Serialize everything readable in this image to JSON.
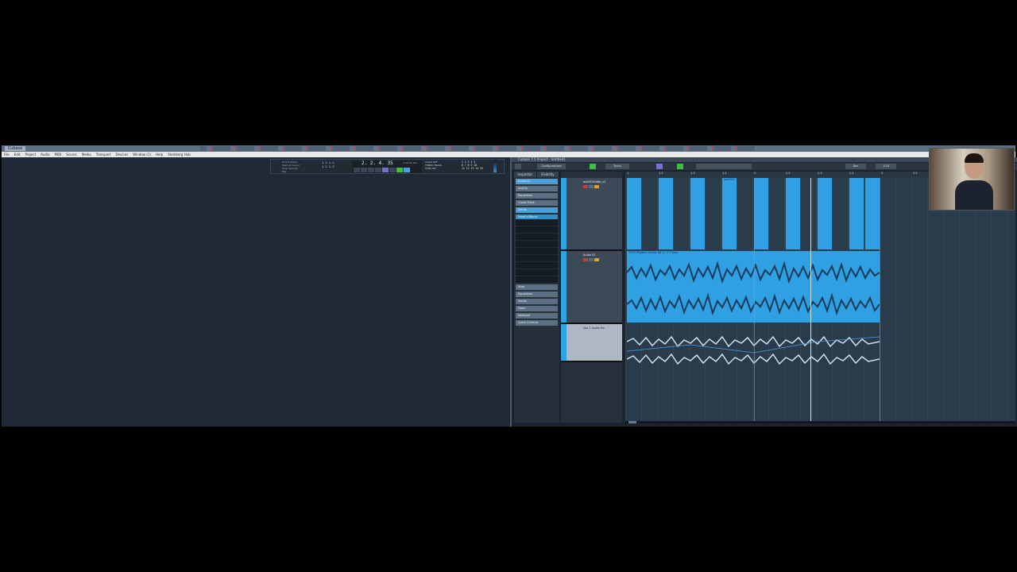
{
  "titlebar": {
    "logo": "Cubase"
  },
  "menu": [
    "File",
    "Edit",
    "Project",
    "Audio",
    "MIDI",
    "Scores",
    "Media",
    "Transport",
    "Devices",
    "Window (1)",
    "Help",
    "Steinberg Hub"
  ],
  "transport": {
    "markers": [
      "Punch In/Out",
      "Start at Cursor",
      "Stop Velocity",
      "Mix"
    ],
    "positions": [
      "1. 1. 1. 0",
      "1. 1. 1. 0"
    ],
    "time": "2. 2. 4. 35",
    "time_sub": "0:00:02.362",
    "click": [
      "CLICK OFF",
      "TEMPO TRACK",
      "SYNC INT"
    ],
    "grid": [
      "1 2 3 4 5",
      "6 7 8 9 10",
      "11 12 13 14 15"
    ]
  },
  "cubase": {
    "title": "Cubase 7.5 Project - Untitled1",
    "toolbar": {
      "configurations": "Configurations",
      "touch": "Touch",
      "bar": "Bar",
      "quantize": "1/16"
    }
  },
  "inspector": {
    "tabs": [
      "Inspector",
      "Visibility"
    ],
    "sections_top": [
      "Audio 01",
      "Inserts",
      "Equalizers",
      "Chord Track",
      "Sends"
    ],
    "selected_row": "NoteFx/Blocks",
    "sections_bottom": [
      "Strip",
      "Equalizers",
      "Sends",
      "Fader",
      "Notepad",
      "Quick Controls"
    ]
  },
  "tracks": [
    "bdaf31f0d6b_s3",
    "Audio 02",
    "Vox 1 Audio file"
  ],
  "ruler": [
    "1",
    "1.2",
    "1.3",
    "1.4",
    "2",
    "2.2",
    "2.3",
    "2.4",
    "3",
    "3.2"
  ],
  "clips": [
    "bdaf31f",
    "VST3 Rhythm Guitar 88 3 - 1 ? loop"
  ]
}
